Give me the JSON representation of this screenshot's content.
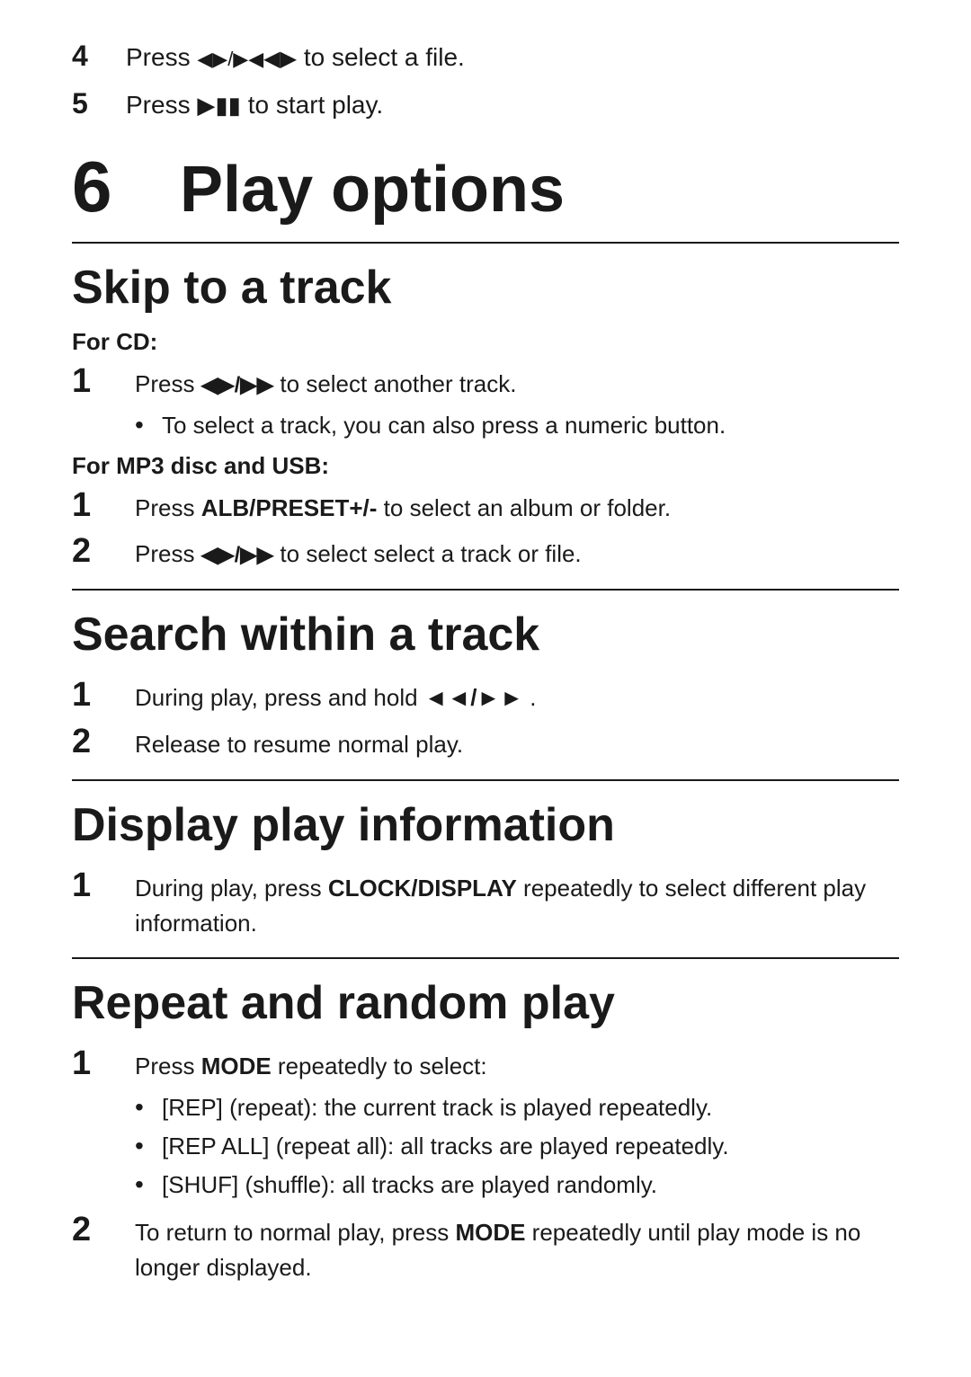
{
  "intro": {
    "steps": [
      {
        "num": "4",
        "text_before": "Press ",
        "icon": "⏮/⏭",
        "text_after": " to select a file."
      },
      {
        "num": "5",
        "text_before": "Press ",
        "icon": "▶⏸",
        "text_after": " to start play."
      }
    ]
  },
  "chapter": {
    "num": "6",
    "title": "Play options"
  },
  "sections": [
    {
      "id": "skip-track",
      "title": "Skip to a track",
      "subsections": [
        {
          "label": "For CD:",
          "steps": [
            {
              "num": "1",
              "content_before": "Press ",
              "icon": "prev-next",
              "content_after": " to select another track."
            }
          ],
          "bullets": [
            "To select a track, you can also press a numeric button."
          ]
        },
        {
          "label": "For MP3 disc and USB:",
          "steps": [
            {
              "num": "1",
              "content_plain": "Press ALB/PRESET+/- to select an album or folder.",
              "bold_parts": [
                "ALB/PRESET+/-"
              ]
            },
            {
              "num": "2",
              "content_before": "Press ",
              "icon": "prev-next",
              "content_after": " to select select a track or file."
            }
          ],
          "bullets": []
        }
      ]
    },
    {
      "id": "search-track",
      "title": "Search within a track",
      "steps": [
        {
          "num": "1",
          "content_before": "During play, press and hold ",
          "icon": "fast",
          "content_after": " ."
        },
        {
          "num": "2",
          "content_plain": "Release to resume normal play."
        }
      ]
    },
    {
      "id": "display-info",
      "title": "Display play information",
      "steps": [
        {
          "num": "1",
          "content_before": "During play, press ",
          "bold_word": "CLOCK/DISPLAY",
          "content_after": " repeatedly to select different play information."
        }
      ]
    },
    {
      "id": "repeat-random",
      "title": "Repeat and random play",
      "steps": [
        {
          "num": "1",
          "content_before": "Press ",
          "bold_word": "MODE",
          "content_after": " repeatedly to select:"
        },
        {
          "num": "2",
          "content_before": "To return to normal play, press ",
          "bold_word": "MODE",
          "content_after": " repeatedly until play mode is no longer displayed."
        }
      ],
      "bullets_after_step1": [
        "[REP] (repeat): the current track is played repeatedly.",
        "[REP ALL] (repeat all): all tracks are played repeatedly.",
        "[SHUF] (shuffle): all tracks are played randomly."
      ]
    }
  ],
  "icons": {
    "prev_next": "⏮/⏭",
    "play_pause": "▶⏸",
    "fast_fwd_rev": "◄◄/▶▶"
  }
}
